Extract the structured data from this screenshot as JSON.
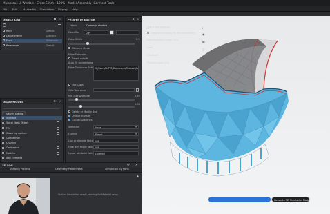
{
  "titlebar": {
    "title": "Marvelous UI Window - Cross Stitch - 100% - Model Assembly (Garment Tools)"
  },
  "menu": [
    "File",
    "Edit",
    "Assembly",
    "Simulation",
    "Display",
    "Help"
  ],
  "object_list": {
    "title": "OBJECT LIST",
    "items": [
      {
        "label": "Rect",
        "value": "Default"
      },
      {
        "label": "Dtaile Frame",
        "value": "Diamond"
      },
      {
        "label": "Front",
        "value": "Dimension"
      },
      {
        "label": "Reference",
        "value": "Default"
      }
    ]
  },
  "properties": {
    "title": "PROPERTY EDITOR",
    "tabs": [
      "Fabric",
      "Common shadow"
    ],
    "color_label": "Color Bar",
    "color_value": "Clay",
    "sec_label": "Distance Mode",
    "edge_label": "Edge Width",
    "edge_value": "0.5",
    "uv_label": "Edge Extrusion",
    "fill_label": "Auto fill connections",
    "fill_check": "Select auto fit",
    "depth_label": "Edge Thickness Setting",
    "path_value": "C:/Users/KUTTE/Documents/Textures/fabric_map.png",
    "use_label": "Use Class",
    "grip_label": "Grip Tolerance",
    "mid_label": "Mid Size Distance",
    "mid_value": "0.65",
    "grid_value": "0.04",
    "checks": [
      "Delete or Modify Box",
      "Unique Transfer",
      "Cloud Guidelines"
    ],
    "selection_label": "Selection",
    "selection_value": "None",
    "outline_label": "Outline",
    "outline_value": "Preset",
    "low_label": "Low grid mode factor",
    "low_value": "0.8",
    "high_label": "Hide dim mode factor",
    "high_value": "0.8",
    "upper_label": "Upper attribute factor",
    "upper_value": "Layered"
  },
  "layer_panel": {
    "title": "DRAW MODES",
    "search_label": "Search Setting",
    "items": [
      "Inverted",
      "Spiral Mesh Object",
      "Fill",
      "Wavering surface",
      "Comparison",
      "Channel",
      "Contrasted",
      "Modifier",
      "Add Elements"
    ]
  },
  "bottom": {
    "title": "3D LOG",
    "tabs": [
      "Shading Process",
      "Geometry Parameters",
      "Simulation by Parts"
    ],
    "log_text": "Status: Simulation ready, waiting for Material setup"
  },
  "overlay": {
    "items": [
      "Fabric Intersection",
      "Draw the shadow Fit the mainframe",
      "Edit thickness mode (3D)",
      "Cast",
      "UV Mode",
      "Pinned mesh (UV)"
    ]
  },
  "progress_button": "Generate 3D Simulation Model",
  "colors": {
    "viewport_top": "#e9eaec",
    "viewport_bottom": "#f3f4f5",
    "model_blue": "#5cb6e0",
    "trim_red": "#d33232",
    "accent": "#2b72d6"
  }
}
